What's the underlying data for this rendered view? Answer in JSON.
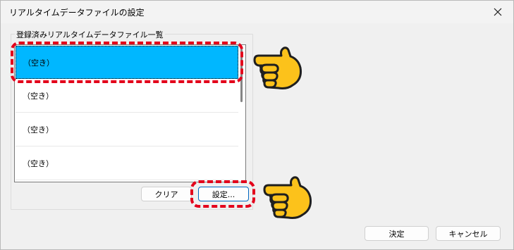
{
  "window": {
    "title": "リアルタイムデータファイルの設定",
    "close_icon": "close-icon"
  },
  "group": {
    "label": "登録済みリアルタイムデータファイル一覧"
  },
  "list": {
    "items": [
      {
        "label": "（空き）",
        "selected": true
      },
      {
        "label": "（空き）",
        "selected": false
      },
      {
        "label": "（空き）",
        "selected": false
      },
      {
        "label": "（空き）",
        "selected": false
      }
    ]
  },
  "buttons": {
    "clear_label": "クリア",
    "settings_label": "設定...",
    "ok_label": "決定",
    "cancel_label": "キャンセル"
  },
  "annotations": {
    "highlight_color": "#e3001b",
    "pointer_icon": "pointing-hand-icon",
    "selection_color": "#00b7ff"
  }
}
